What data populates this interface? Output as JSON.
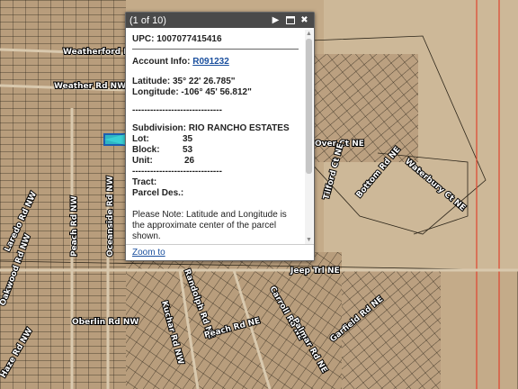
{
  "map": {
    "road_labels": [
      "Weatherford Rd NW",
      "Weather Rd NW",
      "Over Ct NE",
      "Waterbury Ct NE",
      "Bottom Rd NE",
      "Tilford Ct NE",
      "Laredo Rd NW",
      "Peach Rd NW",
      "Oceanside Rd NW",
      "Jeep Trl NE",
      "Oberlin Rd NW",
      "Carroll Rd NE",
      "Randolph Rd NE",
      "Peach Rd NE",
      "Garfield Rd NE",
      "Kuchar Rd NW",
      "Oakwood Rd NW",
      "Palmar Rd NE",
      "Haze Rd NW"
    ]
  },
  "popup": {
    "count": "(1 of 10)",
    "icons": [
      "next-arrow-icon",
      "maximize-icon",
      "close-icon"
    ],
    "upc": "UPC: 1007077415416",
    "account_label": "Account Info:",
    "account_link": "R091232",
    "latitude": "Latitude: 35° 22' 26.785\"",
    "longitude": "Longitude: -106° 45' 56.812\"",
    "dashes": "------------------------------",
    "subdivision": "Subdivision: RIO RANCHO ESTATES",
    "lot_label": "Lot:",
    "lot_value": "35",
    "block_label": "Block:",
    "block_value": "53",
    "unit_label": "Unit:",
    "unit_value": "26",
    "dashes2": "------------------------------",
    "tract": "Tract:",
    "parcel": "Parcel Des.:",
    "note": "Please Note: Latitude and Longitude is the approximate center of the parcel shown.",
    "zoom": "Zoom to"
  }
}
